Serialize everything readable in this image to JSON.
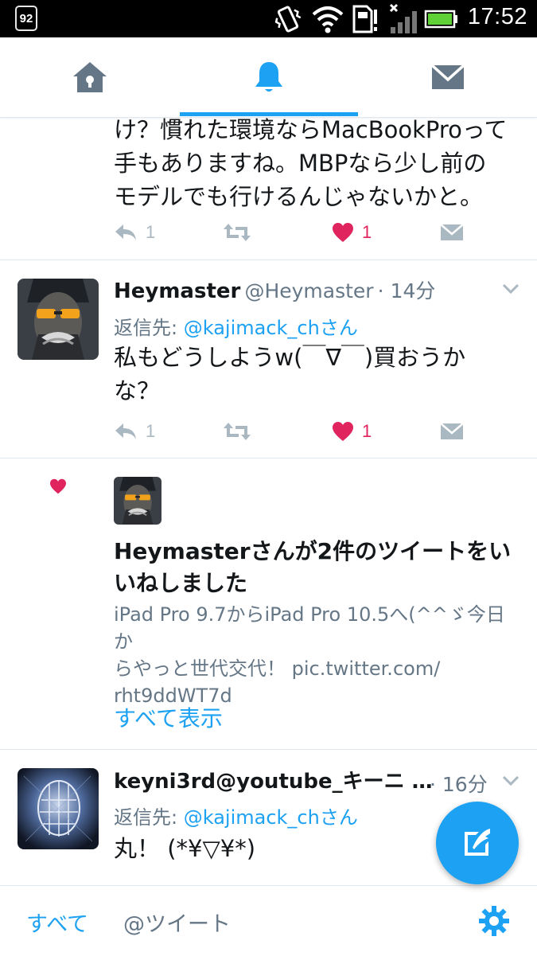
{
  "status_bar": {
    "notification_badge": "92",
    "time": "17:52"
  },
  "nav": {
    "tabs": [
      {
        "name": "home",
        "icon": "home-icon"
      },
      {
        "name": "notifications",
        "icon": "bell-icon",
        "active": true
      },
      {
        "name": "messages",
        "icon": "envelope-icon"
      }
    ],
    "accent_color": "#1da1f2"
  },
  "feed": {
    "item1": {
      "text_lines": [
        "け？慣れた環境ならMacBookProって",
        "手もありますね。MBPなら少し前の",
        "モデルでも行けるんじゃないかと。"
      ],
      "reply_count": "1",
      "like_count": "1"
    },
    "item2": {
      "name": "Heymaster",
      "handle": "@Heymaster",
      "time": "· 14分",
      "reply_prefix": "返信先: ",
      "reply_link": "@kajimack_ch",
      "reply_suffix": "さん",
      "text_line1": "私もどうしようw(￣∇￣)買おうか",
      "text_line2": "な？",
      "reply_count": "1",
      "like_count": "1"
    },
    "item3": {
      "title_line1": "Heymasterさんが2件のツイートをい",
      "title_line2": "いねしました",
      "desc_line1": "iPad Pro 9.7からiPad Pro 10.5へ(^^ゞ今日か",
      "desc_line2": "らやっと世代交代！ pic.twitter.com/",
      "desc_line3": "rht9ddWT7d",
      "show_all": "すべて表示"
    },
    "item4": {
      "name": "keyni3rd@youtube_キーニ …",
      "time": "· 16分",
      "reply_prefix": "返信先: ",
      "reply_link": "@kajimack_ch",
      "reply_suffix": "さん",
      "text": "丸！ (*¥▽¥*)"
    }
  },
  "bottom_bar": {
    "tab_all": "すべて",
    "tab_mentions": "@ツイート"
  },
  "colors": {
    "like_red": "#e0245e",
    "link_blue": "#1da1f2",
    "muted_gray": "#657786",
    "icon_gray": "#aab8c2"
  }
}
